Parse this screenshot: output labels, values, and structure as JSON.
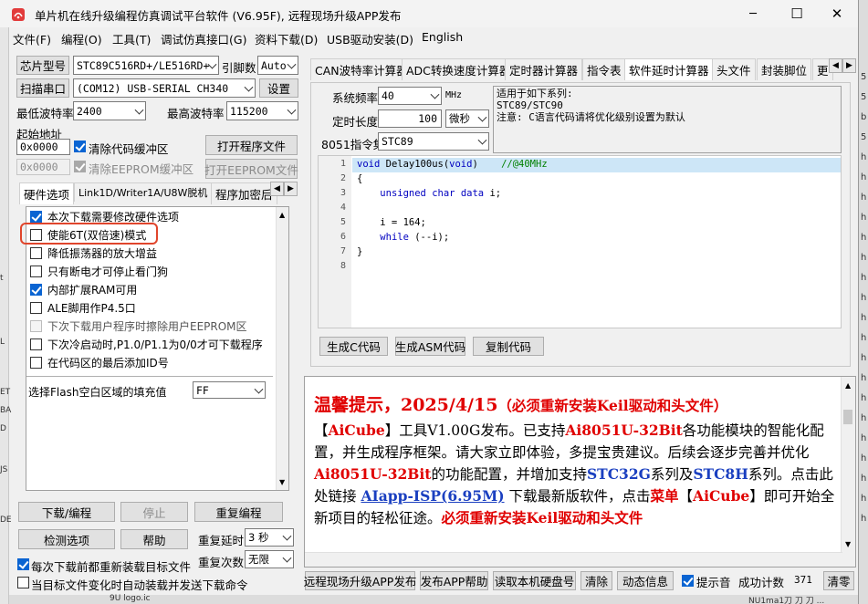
{
  "window": {
    "title": "单片机在线升级编程仿真调试平台软件 (V6.95F), 远程现场升级APP发布",
    "minimize": "─",
    "maximize": "☐",
    "close": "✕"
  },
  "menu": [
    "文件(F)",
    "编程(O)",
    "工具(T)",
    "调试仿真接口(G)",
    "资料下载(D)",
    "USB驱动安装(D)",
    "English"
  ],
  "left": {
    "chip_btn": "芯片型号",
    "chip_value": "STC89C516RD+/LE516RD+",
    "pin_label": "引脚数",
    "pin_value": "Auto",
    "scan_btn": "扫描串口",
    "port_value": "(COM12) USB-SERIAL CH340",
    "settings_btn": "设置",
    "min_baud_label": "最低波特率",
    "min_baud_value": "2400",
    "max_baud_label": "最高波特率",
    "max_baud_value": "115200",
    "start_addr_label": "起始地址",
    "addr1_value": "0x0000",
    "clear_code_label": "清除代码缓冲区",
    "open_prog_btn": "打开程序文件",
    "addr2_value": "0x0000",
    "clear_eeprom_label": "清除EEPROM缓冲区",
    "open_eeprom_btn": "打开EEPROM文件"
  },
  "left_tabs": [
    "硬件选项",
    "Link1D/Writer1A/U8W脱机",
    "程序加密后"
  ],
  "hw_options": [
    {
      "label": "本次下载需要修改硬件选项",
      "checked": true,
      "disabled": false
    },
    {
      "label": "使能6T(双倍速)模式",
      "checked": false,
      "disabled": false
    },
    {
      "label": "降低振荡器的放大增益",
      "checked": false,
      "disabled": false
    },
    {
      "label": "只有断电才可停止看门狗",
      "checked": false,
      "disabled": false
    },
    {
      "label": "内部扩展RAM可用",
      "checked": true,
      "disabled": false
    },
    {
      "label": "ALE脚用作P4.5口",
      "checked": false,
      "disabled": false
    },
    {
      "label": "下次下载用户程序时擦除用户EEPROM区",
      "checked": false,
      "disabled": true
    },
    {
      "label": "下次冷启动时,P1.0/P1.1为0/0才可下载程序",
      "checked": false,
      "disabled": false
    },
    {
      "label": "在代码区的最后添加ID号",
      "checked": false,
      "disabled": false
    }
  ],
  "flash_fill_label": "选择Flash空白区域的填充值",
  "flash_fill_value": "FF",
  "bottom_left": {
    "download_btn": "下载/编程",
    "stop_btn": "停止",
    "reprog_btn": "重复编程",
    "check_btn": "检测选项",
    "help_btn": "帮助",
    "repeat_delay_label": "重复延时",
    "repeat_delay_value": "3 秒",
    "repeat_count_label": "重复次数",
    "repeat_count_value": "无限",
    "reload_label": "每次下载前都重新装载目标文件",
    "reload_checked": true,
    "auto_label": "当目标文件变化时自动装载并发送下载命令",
    "auto_checked": false
  },
  "right_tabs": [
    "CAN波特率计算器",
    "ADC转换速度计算器",
    "定时器计算器",
    "指令表",
    "软件延时计算器",
    "头文件",
    "封装脚位",
    "更"
  ],
  "calc": {
    "freq_label": "系统频率",
    "freq_value": "40",
    "freq_unit": "MHz",
    "delay_label": "定时长度",
    "delay_value": "100",
    "delay_unit": "微秒",
    "isa_label": "8051指令集",
    "isa_value": "STC89",
    "note_line1": "适用于如下系列:",
    "note_line2": "STC89/STC90",
    "note_line3": "注意: C语言代码请将优化级别设置为默认",
    "gen_c_btn": "生成C代码",
    "gen_asm_btn": "生成ASM代码",
    "copy_btn": "复制代码"
  },
  "code_lines": [
    {
      "n": "1",
      "text": "void Delay100us(void)\t//@40MHz"
    },
    {
      "n": "2",
      "text": "{"
    },
    {
      "n": "3",
      "text": "\tunsigned char data i;"
    },
    {
      "n": "4",
      "text": ""
    },
    {
      "n": "5",
      "text": "\ti = 164;"
    },
    {
      "n": "6",
      "text": "\twhile (--i);"
    },
    {
      "n": "7",
      "text": "}"
    },
    {
      "n": "8",
      "text": ""
    }
  ],
  "message": {
    "head": "温馨提示，2025/4/15",
    "head_small": "（必须重新安装Keil驱动和头文件）",
    "p1a": "【",
    "aicube": "AiCube",
    "p1b": "】工具V1.00G发布。已支持",
    "ai8051": "Ai8051U-32Bit",
    "p1c": "各功能模块的智能化配置，并生成程序框架。请大家立即体验，多提宝贵建议。后续会逐步完善并优化",
    "ai8051_2": "Ai8051U-32Bit",
    "p1d": "的功能配置，并增加支持",
    "stc32g": "STC32G",
    "p1e": "系列及",
    "stc8h": "STC8H",
    "p1f": "系列。",
    "p2a": "点击此处链接",
    "link": "AIapp-ISP(6.95M)",
    "p2b": "下载最新版软件，点击",
    "menu_word": "菜单",
    "bracket_l": "【",
    "aicube2": "AiCube",
    "bracket_r": "】",
    "p2c": "即可开始全新项目的轻松征途。",
    "must": "必须重新安装Keil驱动和头文件"
  },
  "status": {
    "remote_btn": "远程现场升级APP发布",
    "publish_help_btn": "发布APP帮助",
    "read_hdd_btn": "读取本机硬盘号",
    "clear_btn": "清除",
    "anim_btn": "动态信息",
    "beep_label": "提示音",
    "beep_checked": true,
    "count_label": "成功计数",
    "count_value": "371",
    "clear2_btn": "清零"
  },
  "bg_right_letters": [
    "5",
    "5",
    "b",
    "5",
    "h",
    "h",
    "h",
    "h",
    "h",
    "h",
    "h",
    "h",
    "h",
    "h",
    "h",
    "h",
    "h",
    "h",
    "h",
    "h",
    "h",
    "h",
    "h"
  ],
  "bg_left_letters": [
    "t",
    "L",
    "ET",
    "BA",
    "D",
    "JS",
    "DE"
  ],
  "bg_bottom_texts": [
    "9U logo.ic",
    "NU1ma1刀 刀 刀 ..."
  ]
}
